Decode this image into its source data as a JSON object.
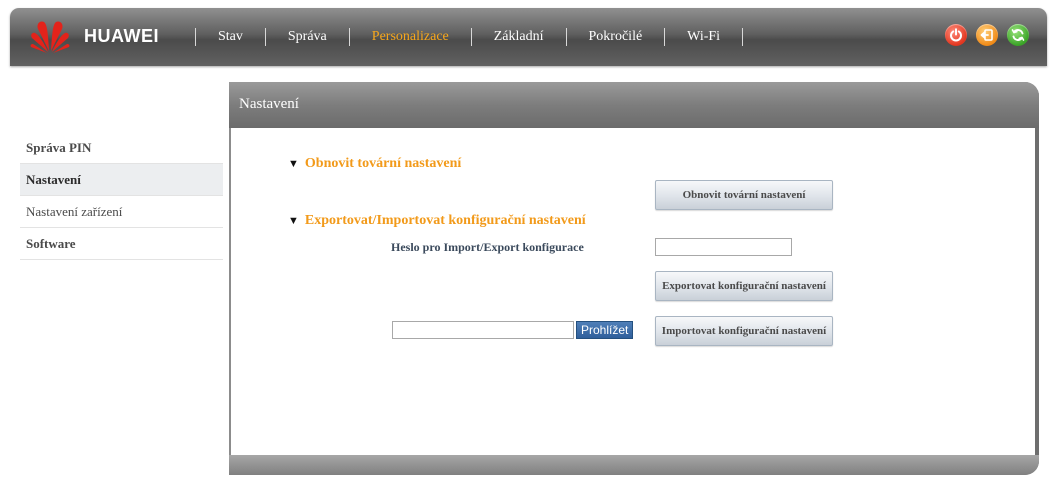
{
  "header": {
    "brand": "HUAWEI",
    "nav": [
      {
        "label": "Stav",
        "active": false
      },
      {
        "label": "Správa",
        "active": false
      },
      {
        "label": "Personalizace",
        "active": true
      },
      {
        "label": "Základní",
        "active": false
      },
      {
        "label": "Pokročilé",
        "active": false
      },
      {
        "label": "Wi-Fi",
        "active": false
      }
    ],
    "icons": [
      "power-icon",
      "logout-icon",
      "refresh-icon"
    ],
    "colors": {
      "active_nav": "#f7a71b",
      "power": "#e2361f",
      "logout": "#f08a17",
      "refresh": "#3aa327"
    }
  },
  "sidebar": {
    "items": [
      {
        "label": "Správa PIN"
      },
      {
        "label": "Nastavení"
      },
      {
        "label": "Nastavení zařízení"
      },
      {
        "label": "Software"
      }
    ]
  },
  "panel": {
    "title": "Nastavení",
    "factory": {
      "title": "Obnovit tovární nastavení",
      "button": "Obnovit tovární nastavení"
    },
    "config": {
      "title": "Exportovat/Importovat konfigurační nastavení",
      "password_label": "Heslo pro Import/Export konfigurace",
      "password_value": "",
      "export_button": "Exportovat konfigurační nastavení",
      "file_value": "",
      "browse_button": "Prohlížet",
      "import_button": "Importovat konfigurační nastavení"
    }
  }
}
